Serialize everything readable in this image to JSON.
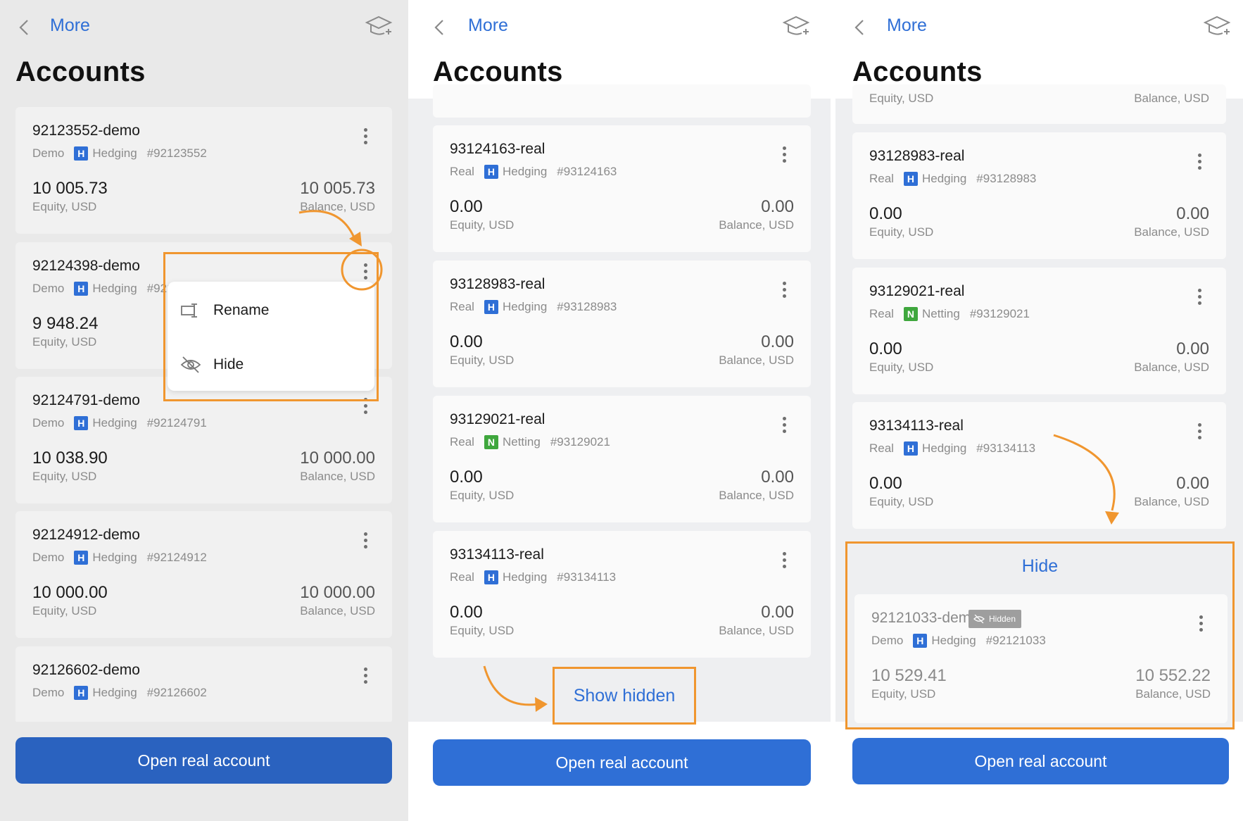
{
  "colors": {
    "accent": "#2f6fd6",
    "highlight": "#f0962f",
    "hedging_badge": "#2f6fd6",
    "netting_badge": "#3fa73d"
  },
  "panels": [
    {
      "nav": {
        "back_icon": "chevron-left-icon",
        "more_label": "More",
        "cap_icon": "graduation-cap-icon"
      },
      "title": "Accounts",
      "accounts": [
        {
          "name": "92123552-demo",
          "type": "Demo",
          "badge": "H",
          "mode": "Hedging",
          "number": "#92123552",
          "equity": "10 005.73",
          "equity_label": "Equity, USD",
          "balance": "10 005.73",
          "balance_label": "Balance, USD"
        },
        {
          "name": "92124398-demo",
          "type": "Demo",
          "badge": "H",
          "mode": "Hedging",
          "number": "#92124398",
          "equity": "9 948.24",
          "equity_label": "Equity, USD",
          "balance": "",
          "balance_label": ""
        },
        {
          "name": "92124791-demo",
          "type": "Demo",
          "badge": "H",
          "mode": "Hedging",
          "number": "#92124791",
          "equity": "10 038.90",
          "equity_label": "Equity, USD",
          "balance": "10 000.00",
          "balance_label": "Balance, USD"
        },
        {
          "name": "92124912-demo",
          "type": "Demo",
          "badge": "H",
          "mode": "Hedging",
          "number": "#92124912",
          "equity": "10 000.00",
          "equity_label": "Equity, USD",
          "balance": "10 000.00",
          "balance_label": "Balance, USD"
        },
        {
          "name": "92126602-demo",
          "type": "Demo",
          "badge": "H",
          "mode": "Hedging",
          "number": "#92126602",
          "equity": "",
          "equity_label": "",
          "balance": "",
          "balance_label": ""
        }
      ],
      "context_menu": {
        "items": [
          {
            "label": "Rename",
            "icon": "rename-icon"
          },
          {
            "label": "Hide",
            "icon": "eye-off-icon"
          }
        ]
      },
      "open_button": "Open real account"
    },
    {
      "nav": {
        "back_icon": "chevron-left-icon",
        "more_label": "More",
        "cap_icon": "graduation-cap-icon"
      },
      "title": "Accounts",
      "accounts": [
        {
          "name": "93124163-real",
          "type": "Real",
          "badge": "H",
          "mode": "Hedging",
          "number": "#93124163",
          "equity": "0.00",
          "equity_label": "Equity, USD",
          "balance": "0.00",
          "balance_label": "Balance, USD"
        },
        {
          "name": "93128983-real",
          "type": "Real",
          "badge": "H",
          "mode": "Hedging",
          "number": "#93128983",
          "equity": "0.00",
          "equity_label": "Equity, USD",
          "balance": "0.00",
          "balance_label": "Balance, USD"
        },
        {
          "name": "93129021-real",
          "type": "Real",
          "badge": "N",
          "mode": "Netting",
          "number": "#93129021",
          "equity": "0.00",
          "equity_label": "Equity, USD",
          "balance": "0.00",
          "balance_label": "Balance, USD"
        },
        {
          "name": "93134113-real",
          "type": "Real",
          "badge": "H",
          "mode": "Hedging",
          "number": "#93134113",
          "equity": "0.00",
          "equity_label": "Equity, USD",
          "balance": "0.00",
          "balance_label": "Balance, USD"
        }
      ],
      "show_hidden": "Show hidden",
      "open_button": "Open real account"
    },
    {
      "nav": {
        "back_icon": "chevron-left-icon",
        "more_label": "More",
        "cap_icon": "graduation-cap-icon"
      },
      "title": "Accounts",
      "partial_labels": {
        "equity": "Equity, USD",
        "balance": "Balance, USD"
      },
      "accounts": [
        {
          "name": "93128983-real",
          "type": "Real",
          "badge": "H",
          "mode": "Hedging",
          "number": "#93128983",
          "equity": "0.00",
          "equity_label": "Equity, USD",
          "balance": "0.00",
          "balance_label": "Balance, USD"
        },
        {
          "name": "93129021-real",
          "type": "Real",
          "badge": "N",
          "mode": "Netting",
          "number": "#93129021",
          "equity": "0.00",
          "equity_label": "Equity, USD",
          "balance": "0.00",
          "balance_label": "Balance, USD"
        },
        {
          "name": "93134113-real",
          "type": "Real",
          "badge": "H",
          "mode": "Hedging",
          "number": "#93134113",
          "equity": "0.00",
          "equity_label": "Equity, USD",
          "balance": "0.00",
          "balance_label": "Balance, USD"
        }
      ],
      "hide_section": {
        "label": "Hide",
        "account": {
          "name": "92121033-demo",
          "hidden_tag": "Hidden",
          "type": "Demo",
          "badge": "H",
          "mode": "Hedging",
          "number": "#92121033",
          "equity": "10 529.41",
          "equity_label": "Equity, USD",
          "balance": "10 552.22",
          "balance_label": "Balance, USD"
        }
      },
      "open_button": "Open real account"
    }
  ]
}
